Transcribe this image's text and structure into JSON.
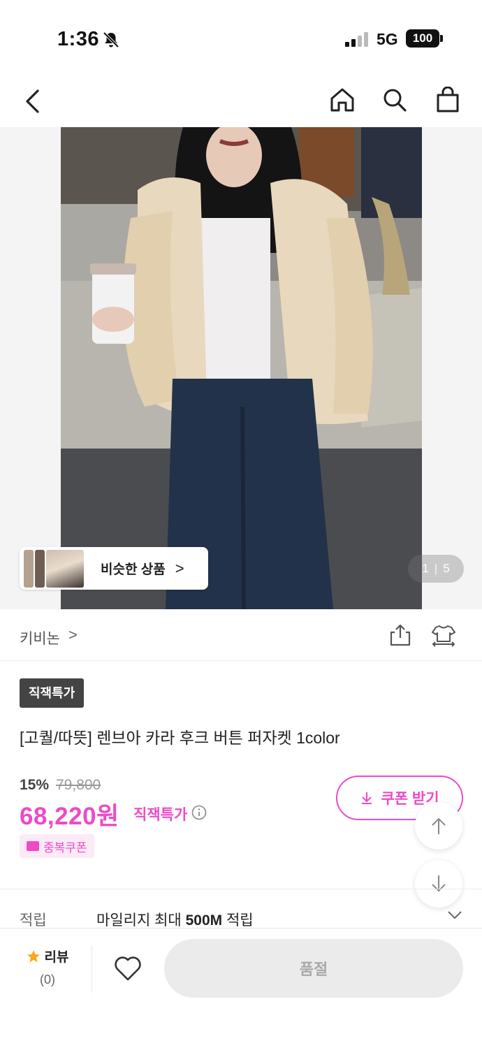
{
  "status_bar": {
    "time": "1:36",
    "network": "5G",
    "battery": "100"
  },
  "nav": {
    "back_icon": "chevron-left-icon",
    "home_icon": "home-icon",
    "search_icon": "search-icon",
    "bag_icon": "shopping-bag-icon"
  },
  "gallery": {
    "similar_label": "비슷한 상품",
    "similar_arrow": ">",
    "page_current": "1",
    "page_separator": "|",
    "page_total": "5"
  },
  "brand": {
    "name": "키비논",
    "chevron": ">"
  },
  "product": {
    "badge": "직잭특가",
    "title": "[고퀄/따뜻] 렌브아 카라 후크 버튼 퍼자켓 1color",
    "discount": "15%",
    "original_price": "79,800",
    "price": "68,220원",
    "price_tag": "직잭특가",
    "coupon_button": "쿠폰 받기",
    "dup_coupon": "중복쿠폰"
  },
  "mileage": {
    "label": "적립",
    "text_prefix": "마일리지 최대 ",
    "text_bold": "500M",
    "text_suffix": " 적립"
  },
  "bottom_bar": {
    "review_label": "리뷰",
    "review_count": "(0)",
    "soldout_label": "품절"
  },
  "colors": {
    "accent": "#ee4ac7",
    "badge_bg": "#444444",
    "soldout_bg": "#ebebeb"
  }
}
